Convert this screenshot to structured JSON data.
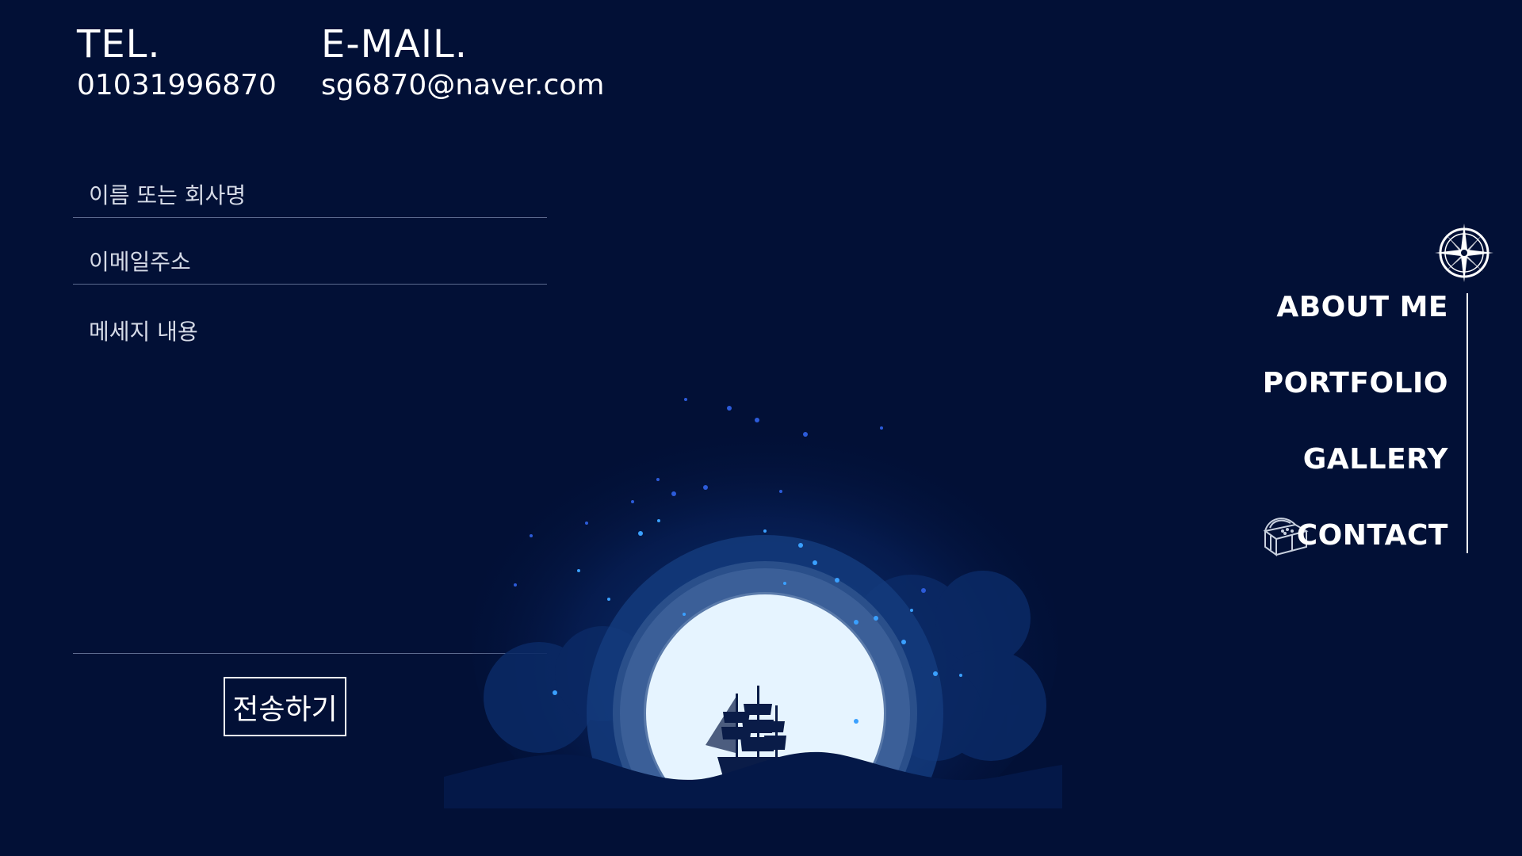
{
  "contact": {
    "tel_label": "TEL.",
    "tel_value": "01031996870",
    "email_label": "E-MAIL.",
    "email_value": "sg6870@naver.com"
  },
  "form": {
    "name_placeholder": "이름 또는 회사명",
    "email_placeholder": "이메일주소",
    "message_placeholder": "메세지 내용",
    "submit_label": "전송하기"
  },
  "nav": {
    "items": [
      {
        "label": "ABOUT ME"
      },
      {
        "label": "PORTFOLIO"
      },
      {
        "label": "GALLERY"
      },
      {
        "label": "CONTACT"
      }
    ],
    "compass_icon": "compass-icon",
    "chest_icon": "treasure-chest-icon"
  },
  "colors": {
    "background": "#021036",
    "moon": "#e6f4ff",
    "accent_glow": "#2f7bd6"
  }
}
